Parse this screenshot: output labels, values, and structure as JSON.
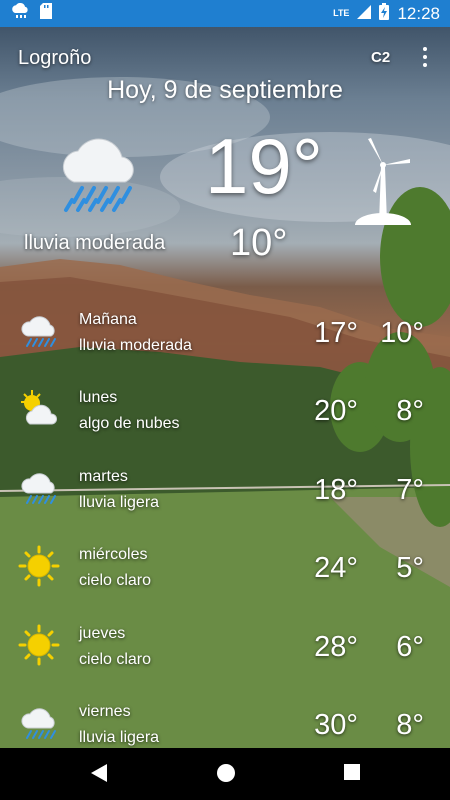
{
  "status_bar": {
    "time": "12:28",
    "network": "LTE",
    "icons": [
      "cloud-rain-icon",
      "sd-card-icon",
      "signal-icon",
      "battery-icon"
    ]
  },
  "header": {
    "city": "Logroño",
    "units_label": "C2",
    "menu_icon": "more-vert-icon",
    "date": "Hoy, 9 de septiembre"
  },
  "current": {
    "temp": "19°",
    "temp_low": "10°",
    "condition": "lluvia moderada",
    "icon": "rain-cloud-icon",
    "wind_icon": "wind-turbine-icon"
  },
  "forecast": [
    {
      "day": "Mañana",
      "desc": "lluvia moderada",
      "hi": "17°",
      "lo": "10°",
      "icon": "rain-cloud-icon"
    },
    {
      "day": "lunes",
      "desc": "algo de nubes",
      "hi": "20°",
      "lo": "8°",
      "icon": "sun-cloud-icon"
    },
    {
      "day": "martes",
      "desc": "lluvia ligera",
      "hi": "18°",
      "lo": "7°",
      "icon": "rain-cloud-icon"
    },
    {
      "day": "miércoles",
      "desc": "cielo claro",
      "hi": "24°",
      "lo": "5°",
      "icon": "sun-icon"
    },
    {
      "day": "jueves",
      "desc": "cielo claro",
      "hi": "28°",
      "lo": "6°",
      "icon": "sun-icon"
    },
    {
      "day": "viernes",
      "desc": "lluvia ligera",
      "hi": "30°",
      "lo": "8°",
      "icon": "rain-cloud-icon"
    }
  ],
  "colors": {
    "status_bar": "#1f7fd0",
    "rain": "#2f8fe0",
    "sun": "#f5d000",
    "nav_bar": "#000000"
  },
  "nav": {
    "icons": [
      "back-icon",
      "home-icon",
      "recents-icon"
    ]
  }
}
